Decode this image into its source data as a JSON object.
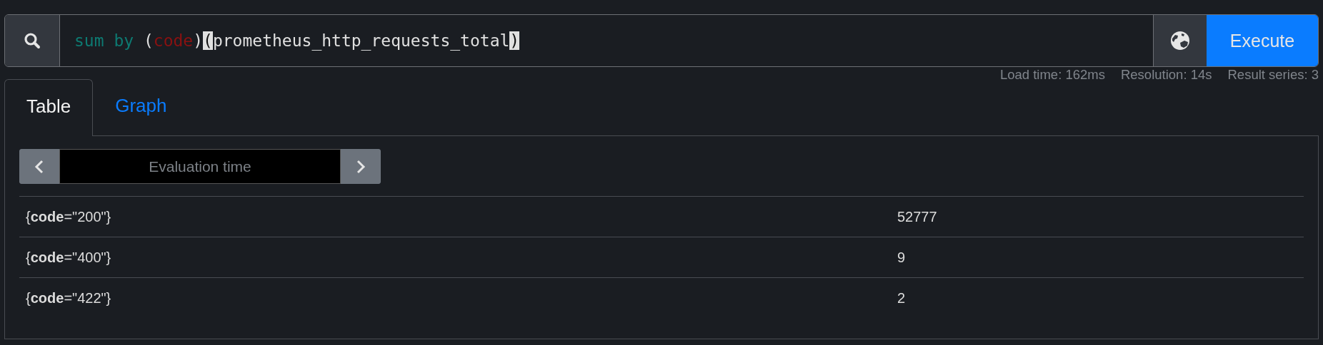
{
  "query": {
    "tokens": [
      {
        "text": "sum by ",
        "kind": "keyword"
      },
      {
        "text": "(",
        "kind": "plain"
      },
      {
        "text": "code",
        "kind": "label"
      },
      {
        "text": ")",
        "kind": "plain"
      },
      {
        "text": "(",
        "kind": "match"
      },
      {
        "text": "prometheus_http_requests_total",
        "kind": "plain"
      },
      {
        "text": ")",
        "kind": "match"
      }
    ]
  },
  "execute_button": "Execute",
  "stats": [
    "Load time: 162ms",
    "Resolution: 14s",
    "Result series: 3"
  ],
  "tabs": [
    {
      "label": "Table",
      "selected": true
    },
    {
      "label": "Graph",
      "selected": false
    }
  ],
  "evaluation_time": {
    "placeholder": "Evaluation time"
  },
  "rows": [
    {
      "series": "{**code**=\"200\"}",
      "value": "52777"
    },
    {
      "series": "{**code**=\"400\"}",
      "value": "9"
    },
    {
      "series": "{**code**=\"422\"}",
      "value": "2"
    }
  ]
}
